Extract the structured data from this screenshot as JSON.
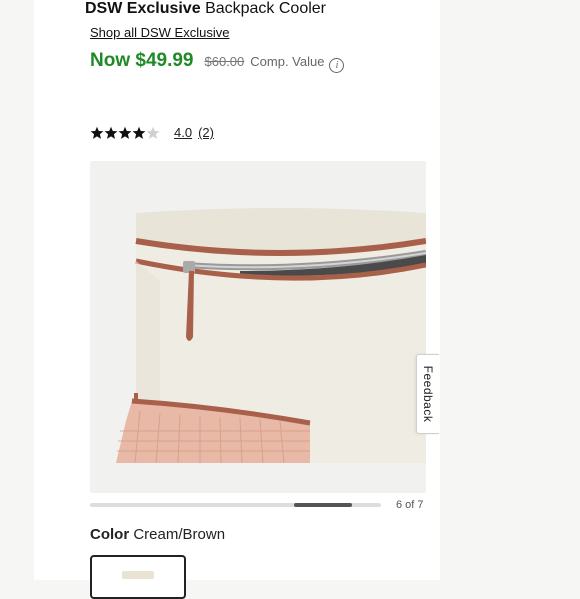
{
  "product": {
    "brand": "DSW Exclusive",
    "name": "Backpack Cooler",
    "shop_all_link": "Shop all DSW Exclusive"
  },
  "pricing": {
    "now_price": "Now $49.99",
    "comp_price": "$60.00",
    "comp_label": "Comp. Value",
    "info_icon": "i"
  },
  "rating": {
    "value": "4.0",
    "count": "(2)",
    "stars_filled": 4,
    "stars_total": 5
  },
  "gallery": {
    "counter": "6 of 7",
    "current_index": 6,
    "total": 7
  },
  "feedback": {
    "label": "Feedback"
  },
  "color": {
    "label": "Color",
    "value": "Cream/Brown"
  },
  "theme": {
    "price_green": "#1f8a26",
    "trim_brown": "#a9604a",
    "canvas_cream": "#eeeae0"
  }
}
